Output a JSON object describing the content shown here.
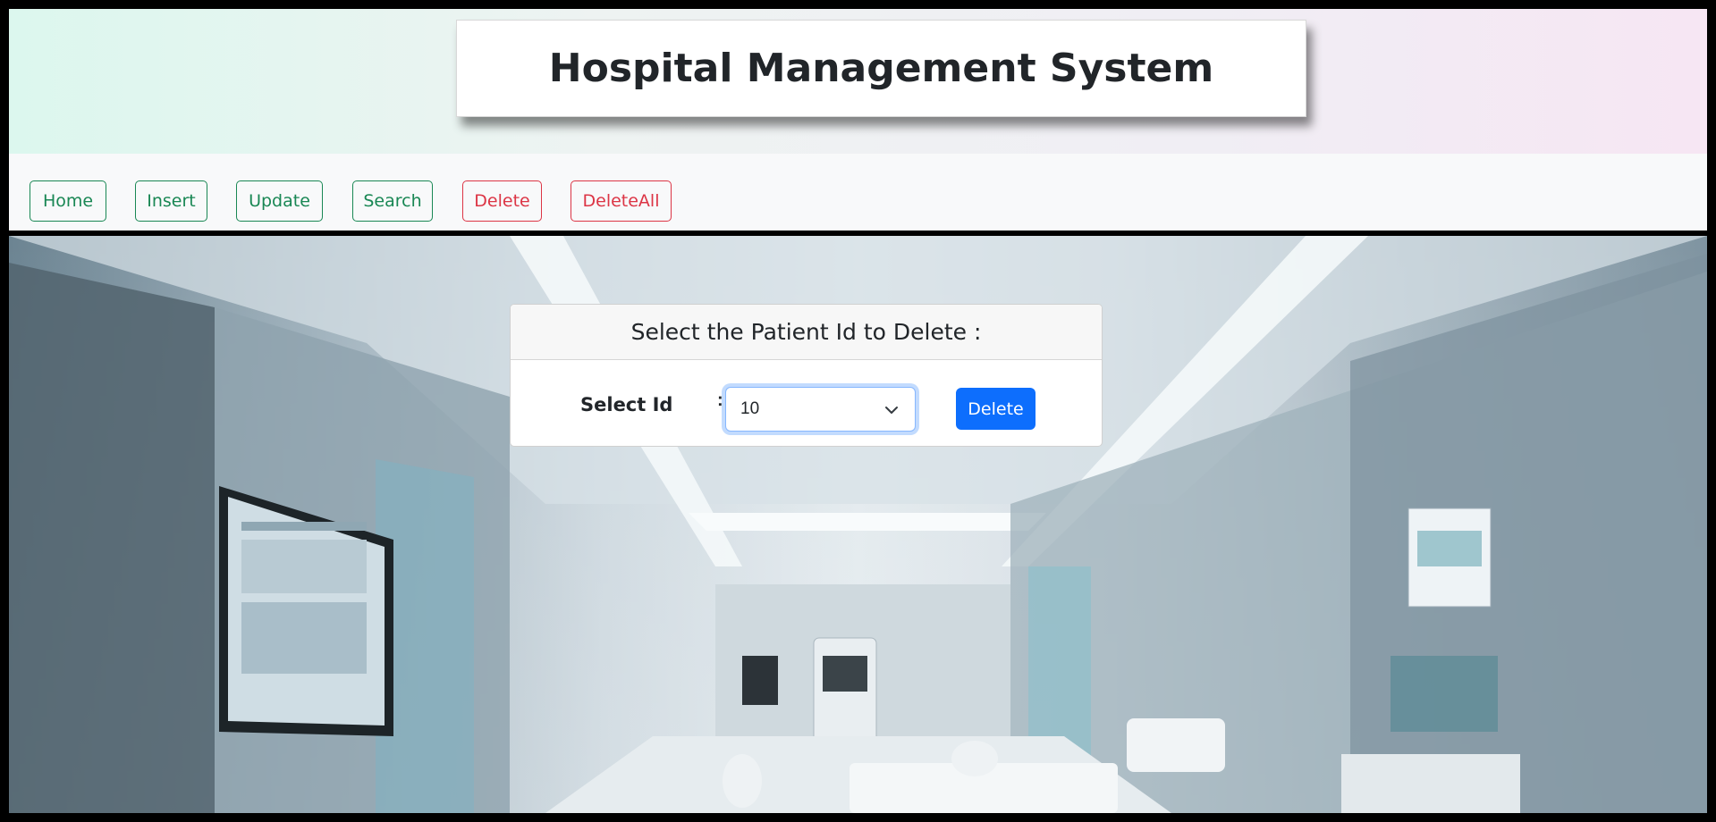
{
  "app": {
    "title": "Hospital Management System"
  },
  "nav": {
    "home": "Home",
    "insert": "Insert",
    "update": "Update",
    "search": "Search",
    "delete": "Delete",
    "delete_all": "DeleteAll"
  },
  "card": {
    "header": "Select the Patient Id to Delete :",
    "label": "Select Id",
    "colon": ":",
    "selected_id": "10",
    "delete_button": "Delete"
  },
  "colors": {
    "success": "#198754",
    "danger": "#dc3545",
    "primary": "#0d6efd"
  },
  "icons": {
    "select_arrow": "chevron-down-icon"
  }
}
